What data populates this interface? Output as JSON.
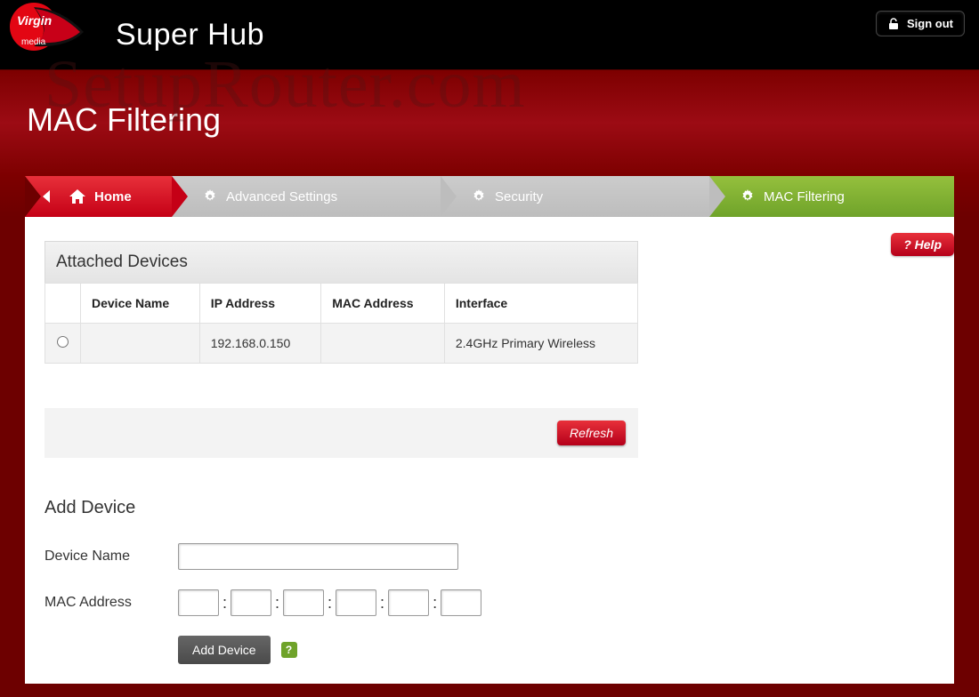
{
  "header": {
    "product_name": "Super Hub",
    "signout_label": "Sign out"
  },
  "page": {
    "title": "MAC Filtering",
    "help_label": "? Help",
    "watermark": "SetupRouter.com"
  },
  "breadcrumb": {
    "home": "Home",
    "advanced": "Advanced Settings",
    "security": "Security",
    "current": "MAC Filtering"
  },
  "attached_devices": {
    "title": "Attached Devices",
    "columns": {
      "device_name": "Device Name",
      "ip_address": "IP Address",
      "mac_address": "MAC Address",
      "interface": "Interface"
    },
    "rows": [
      {
        "device_name": "",
        "ip_address": "192.168.0.150",
        "mac_address": "",
        "interface": "2.4GHz Primary Wireless"
      }
    ],
    "refresh_label": "Refresh"
  },
  "add_device": {
    "title": "Add Device",
    "device_name_label": "Device Name",
    "mac_label": "MAC Address",
    "device_name_value": "",
    "mac_segments": [
      "",
      "",
      "",
      "",
      "",
      ""
    ],
    "add_label": "Add Device"
  }
}
